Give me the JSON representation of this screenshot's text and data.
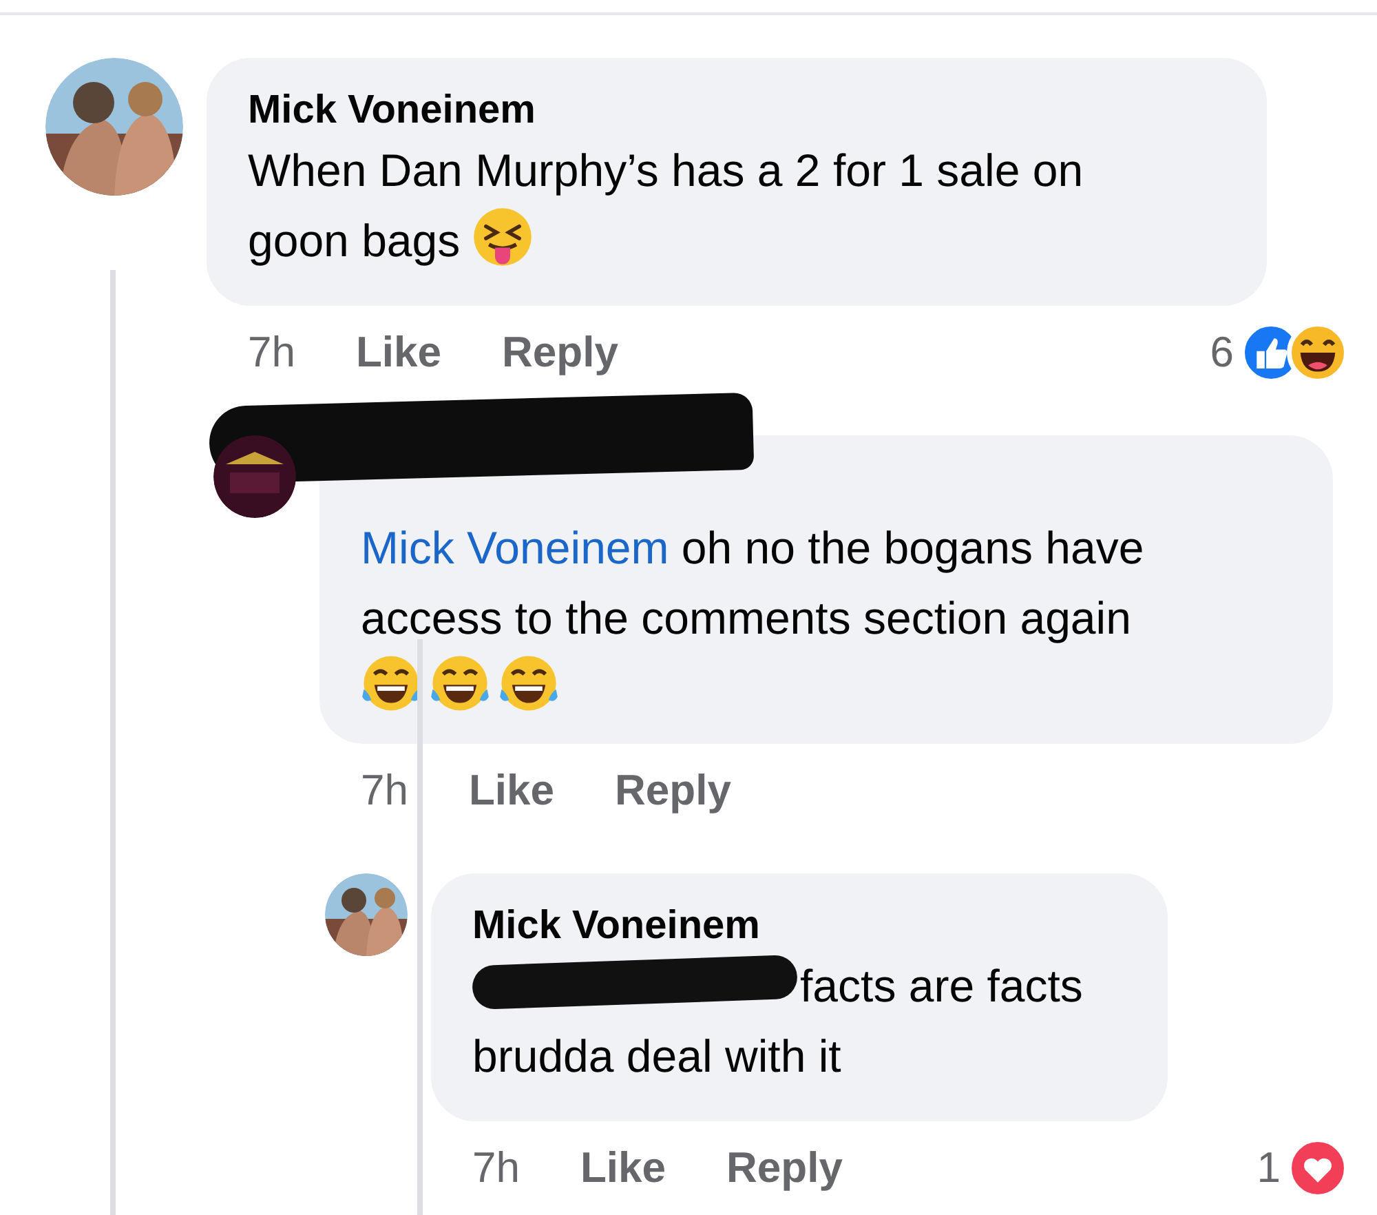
{
  "comments": [
    {
      "author": {
        "name": "Mick Voneinem"
      },
      "body": [
        {
          "kind": "text",
          "text": "When Dan Murphy’s has a 2 for 1 sale on goon bags"
        },
        {
          "kind": "emoji",
          "icon": {
            "kind": "squint-tongue"
          }
        }
      ],
      "time": "7h",
      "actions": [
        "Like",
        "Reply"
      ],
      "reactions": {
        "count": "6",
        "icons": [
          {
            "kind": "like"
          },
          {
            "kind": "haha"
          }
        ]
      },
      "children": [
        {
          "author": {
            "redacted": true
          },
          "body": [
            {
              "kind": "mention",
              "text": "Mick Voneinem"
            },
            {
              "kind": "text",
              "text": " oh no the bogans have access to the comments section again"
            },
            {
              "kind": "emoji-row",
              "icons": [
                {
                  "kind": "tears-joy"
                },
                {
                  "kind": "tears-joy"
                },
                {
                  "kind": "tears-joy"
                }
              ]
            }
          ],
          "time": "7h",
          "actions": [
            "Like",
            "Reply"
          ],
          "children": [
            {
              "author": {
                "name": "Mick Voneinem"
              },
              "body": [
                {
                  "kind": "redacted"
                },
                {
                  "kind": "text",
                  "text": "facts are facts brudda deal with it"
                }
              ],
              "time": "7h",
              "actions": [
                "Like",
                "Reply"
              ],
              "reactions": {
                "count": "1",
                "icons": [
                  {
                    "kind": "love"
                  }
                ]
              }
            }
          ]
        }
      ]
    }
  ]
}
